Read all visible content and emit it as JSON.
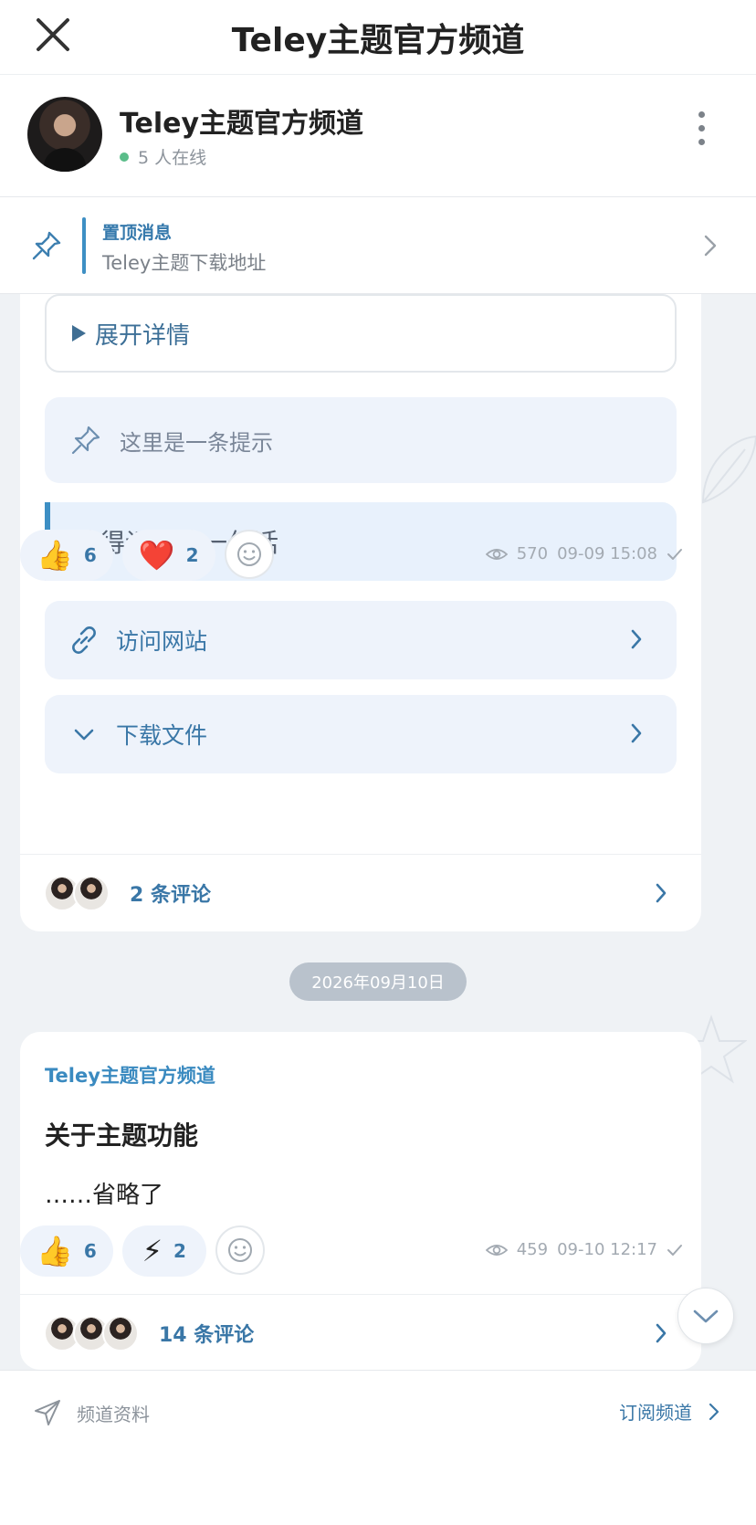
{
  "topbar": {
    "title": "Teley主题官方频道"
  },
  "channel": {
    "name": "Teley主题官方频道",
    "online": "5 人在线"
  },
  "pinned": {
    "label": "置顶消息",
    "text": "Teley主题下载地址"
  },
  "message1": {
    "expand_label": "展开详情",
    "tip_text": "这里是一条提示",
    "quote_text": "值得记录的一句话",
    "visit_label": "访问网站",
    "download_label": "下载文件",
    "reactions": [
      {
        "emoji": "👍",
        "count": "6",
        "icon": "thumbs-up-icon"
      },
      {
        "emoji": "❤️",
        "count": "2",
        "icon": "heart-icon"
      }
    ],
    "views": "570",
    "time": "09-09 15:08",
    "comments": "2 条评论"
  },
  "date_separator": "2026年09月10日",
  "message2": {
    "sender": "Teley主题官方频道",
    "title": "关于主题功能",
    "body": "……省略了",
    "reactions": [
      {
        "emoji": "👍",
        "count": "6",
        "icon": "thumbs-up-icon"
      },
      {
        "emoji": "⚡",
        "count": "2",
        "icon": "lightning-icon"
      }
    ],
    "views": "459",
    "time": "09-10 12:17",
    "comments": "14 条评论"
  },
  "bottom_bar": {
    "profile_label": "频道资料",
    "subscribe_label": "订阅频道"
  },
  "colors": {
    "accent": "#3a77a7",
    "pin_bar": "#3d8fc4",
    "online": "#5bbd8a",
    "background": "#eff2f5"
  }
}
